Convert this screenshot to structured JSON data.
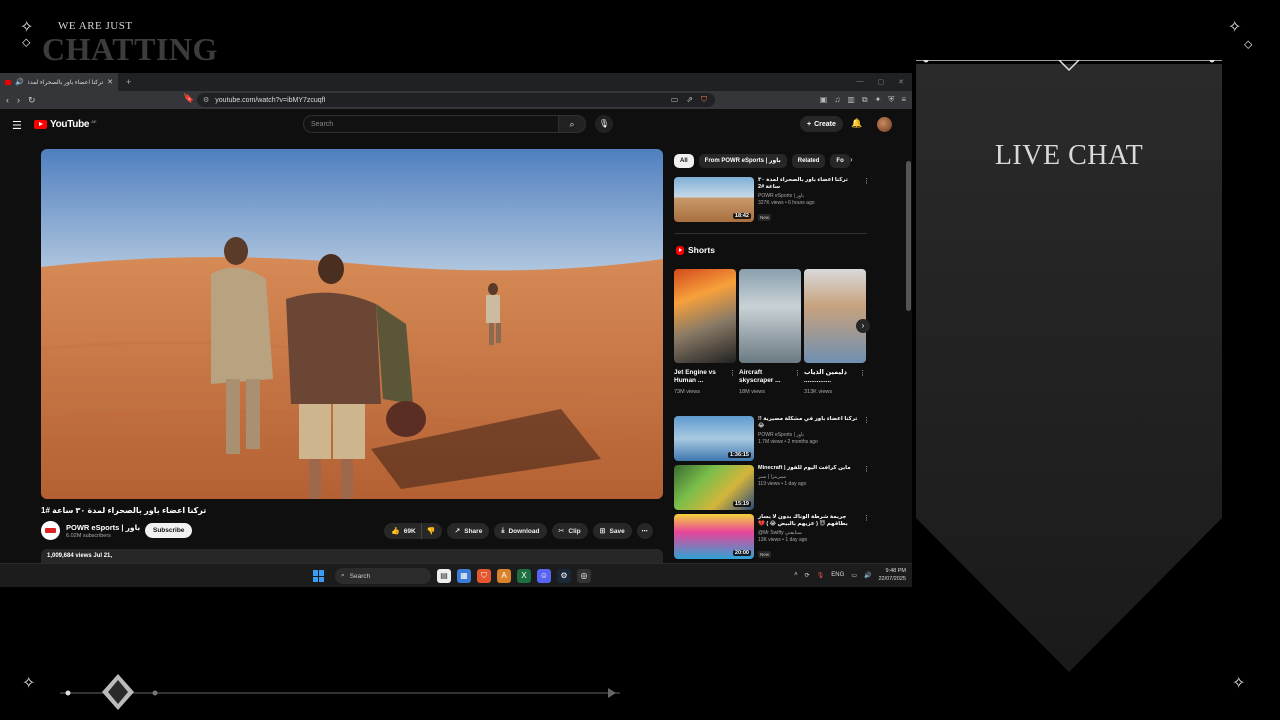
{
  "overlay": {
    "tagline": "WE ARE JUST",
    "title": "CHATTING",
    "chat_title": "LIVE CHAT"
  },
  "browser": {
    "tab_title": "تركنا اعضاء باور بالصحراء لمدة",
    "new_tab": "+",
    "url": "youtube.com/watch?v=ibMY7zcuqfI"
  },
  "youtube": {
    "logo_text": "YouTube",
    "logo_country": "AE",
    "search_placeholder": "Search",
    "create_label": "Create",
    "video": {
      "title": "تركنا اعضاء باور بالصحراء لمدة ٣٠ ساعة #1",
      "channel": "POWR eSports | باور",
      "subscribers": "6.02M subscribers",
      "subscribe_label": "Subscribe",
      "likes": "69K",
      "share_label": "Share",
      "download_label": "Download",
      "clip_label": "Clip",
      "save_label": "Save",
      "meta": "1,009,684 views  Jul 21,"
    },
    "chips": [
      {
        "label": "All"
      },
      {
        "label": "From POWR eSports | باور"
      },
      {
        "label": "Related"
      },
      {
        "label": "Fo"
      }
    ],
    "top_rec": {
      "title": "تركنا اعضاء باور بالصحراء لمدة ٣٠ ساعة #2",
      "channel": "POWR eSports | باور",
      "meta": "327K views • 6 hours ago",
      "badge": "New",
      "duration": "18:42"
    },
    "shorts_heading": "Shorts",
    "shorts": [
      {
        "title": "Jet Engine vs Human ...",
        "views": "73M views"
      },
      {
        "title": "Aircraft skyscraper ...",
        "views": "18M views"
      },
      {
        "title": "دليمين الذياب ...............",
        "views": "313K views"
      }
    ],
    "recs": [
      {
        "title": "تركنا اعضاء باور في مشكلة مصيرية !! 😂",
        "channel": "POWR eSports | باور",
        "meta": "1.7M views • 2 months ago",
        "badge": "",
        "duration": "1:36:15"
      },
      {
        "title": "Minecraft | ماين كرافت اليوم للفوز",
        "channel": "سبرينزا | سبر",
        "meta": "119 views • 1 day ago",
        "badge": "",
        "duration": "15:19"
      },
      {
        "title": "جريمة شرطة الوناك بدون لا يسار بطاقهم 😈 ( عزيهم بالبيض 😂 ) 💔",
        "channel": "@Mr Swifty سنايفتي",
        "meta": "13K views • 1 day ago",
        "badge": "New",
        "duration": "20:00"
      }
    ]
  },
  "taskbar": {
    "search_label": "Search",
    "lang": "ENG",
    "time": "9:48 PM",
    "date": "22/07/2025"
  }
}
